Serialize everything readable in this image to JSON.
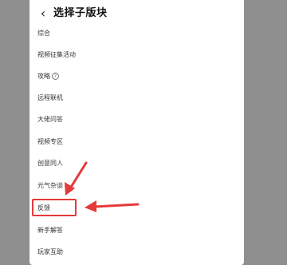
{
  "header": {
    "back_icon": "chevron-left-icon",
    "title": "选择子版块"
  },
  "items": [
    {
      "label": "综合"
    },
    {
      "label": "视频征集活动"
    },
    {
      "label": "攻略",
      "has_help_icon": true
    },
    {
      "label": "远程联机"
    },
    {
      "label": "大佬问答"
    },
    {
      "label": "视频专区"
    },
    {
      "label": "创意同人"
    },
    {
      "label": "元气杂谈"
    },
    {
      "label": "反馈",
      "highlighted": true
    },
    {
      "label": "新手解答"
    },
    {
      "label": "玩家互助"
    }
  ],
  "annotation": {
    "color": "#e53a3a",
    "target": "反馈"
  }
}
